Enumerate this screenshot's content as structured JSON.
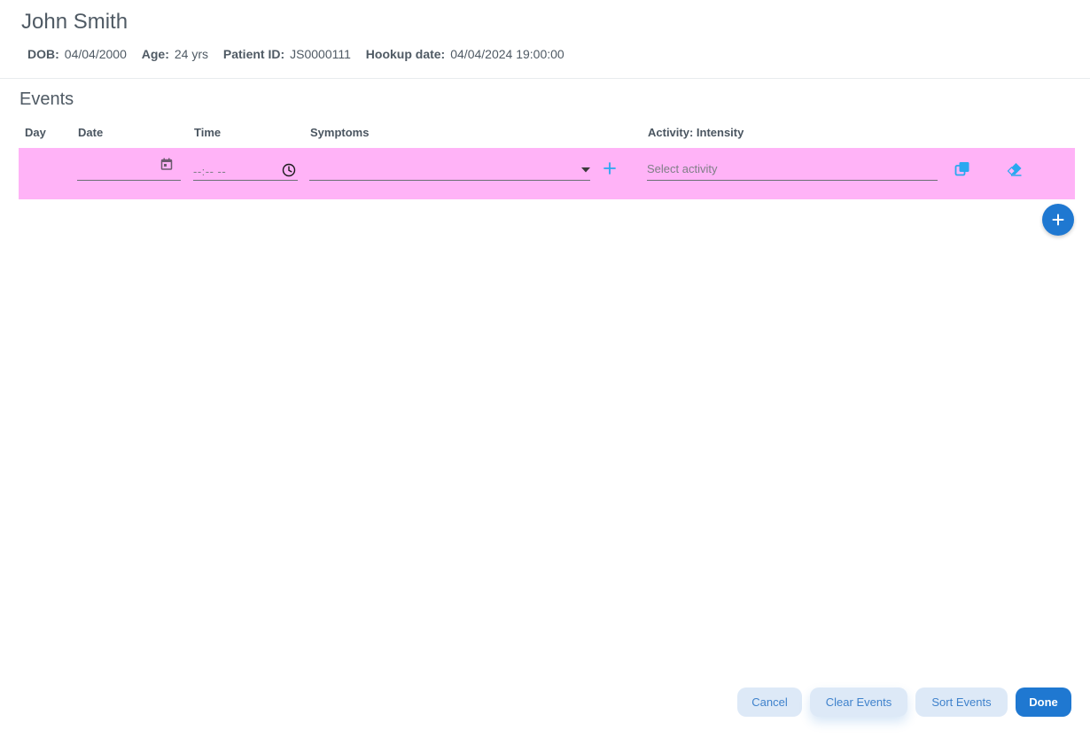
{
  "patient": {
    "name": "John Smith",
    "dob_label": "DOB:",
    "dob": "04/04/2000",
    "age_label": "Age:",
    "age": "24 yrs",
    "id_label": "Patient ID:",
    "id": "JS0000111",
    "hookup_label": "Hookup date:",
    "hookup": "04/04/2024 19:00:00"
  },
  "events": {
    "title": "Events",
    "columns": {
      "day": "Day",
      "date": "Date",
      "time": "Time",
      "symptoms": "Symptoms",
      "activity": "Activity: Intensity"
    },
    "rows": [
      {
        "day": "",
        "date": "",
        "time_placeholder": "--:-- --",
        "symptoms": "",
        "activity_placeholder": "Select activity",
        "highlight_color": "#ffb3f7"
      }
    ]
  },
  "icons": {
    "date": "calendar-icon",
    "time": "clock-icon",
    "dropdown": "caret-down-icon",
    "add_symptom": "plus-icon",
    "duplicate": "copy-icon",
    "clear": "eraser-icon",
    "add_row": "plus-circle-icon"
  },
  "colors": {
    "accent": "#1f78d1",
    "accent_light": "#dde9f7",
    "icon_accent": "#29a8f0",
    "row_highlight": "#ffb3f7"
  },
  "footer": {
    "cancel": "Cancel",
    "clear_events": "Clear Events",
    "sort_events": "Sort Events",
    "done": "Done"
  }
}
